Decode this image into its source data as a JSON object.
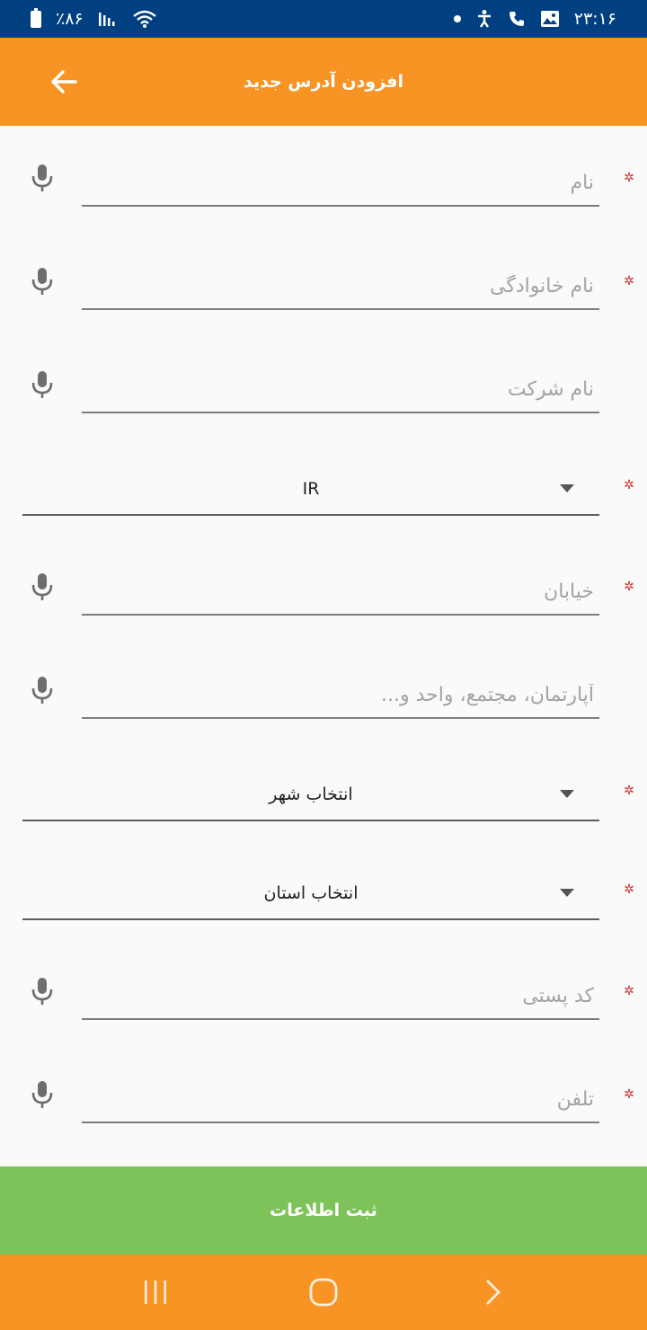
{
  "status_bar": {
    "battery_text": "٪۸۶",
    "time": "۲۳:۱۶"
  },
  "header": {
    "title": "افزودن آدرس جدید",
    "back_icon": "arrow-back-icon"
  },
  "form": {
    "first_name": {
      "placeholder": "نام",
      "required": true
    },
    "last_name": {
      "placeholder": "نام خانوادگی",
      "required": true
    },
    "company": {
      "placeholder": "نام شرکت",
      "required": false
    },
    "country": {
      "value": "IR",
      "required": true
    },
    "street": {
      "placeholder": "خیابان",
      "required": true
    },
    "apartment": {
      "placeholder": "آپارتمان، مجتمع، واحد و...",
      "required": false
    },
    "city": {
      "value": "انتخاب شهر",
      "required": true
    },
    "state": {
      "value": "انتخاب استان",
      "required": true
    },
    "postal_code": {
      "placeholder": "کد پستی",
      "required": true
    },
    "phone": {
      "placeholder": "تلفن",
      "required": true
    },
    "required_marker": "✲"
  },
  "submit": {
    "label": "ثبت اطلاعات"
  },
  "colors": {
    "status_bar": "#004080",
    "app_bar": "#f79424",
    "submit": "#7dc35a",
    "required": "#d32f2f"
  }
}
